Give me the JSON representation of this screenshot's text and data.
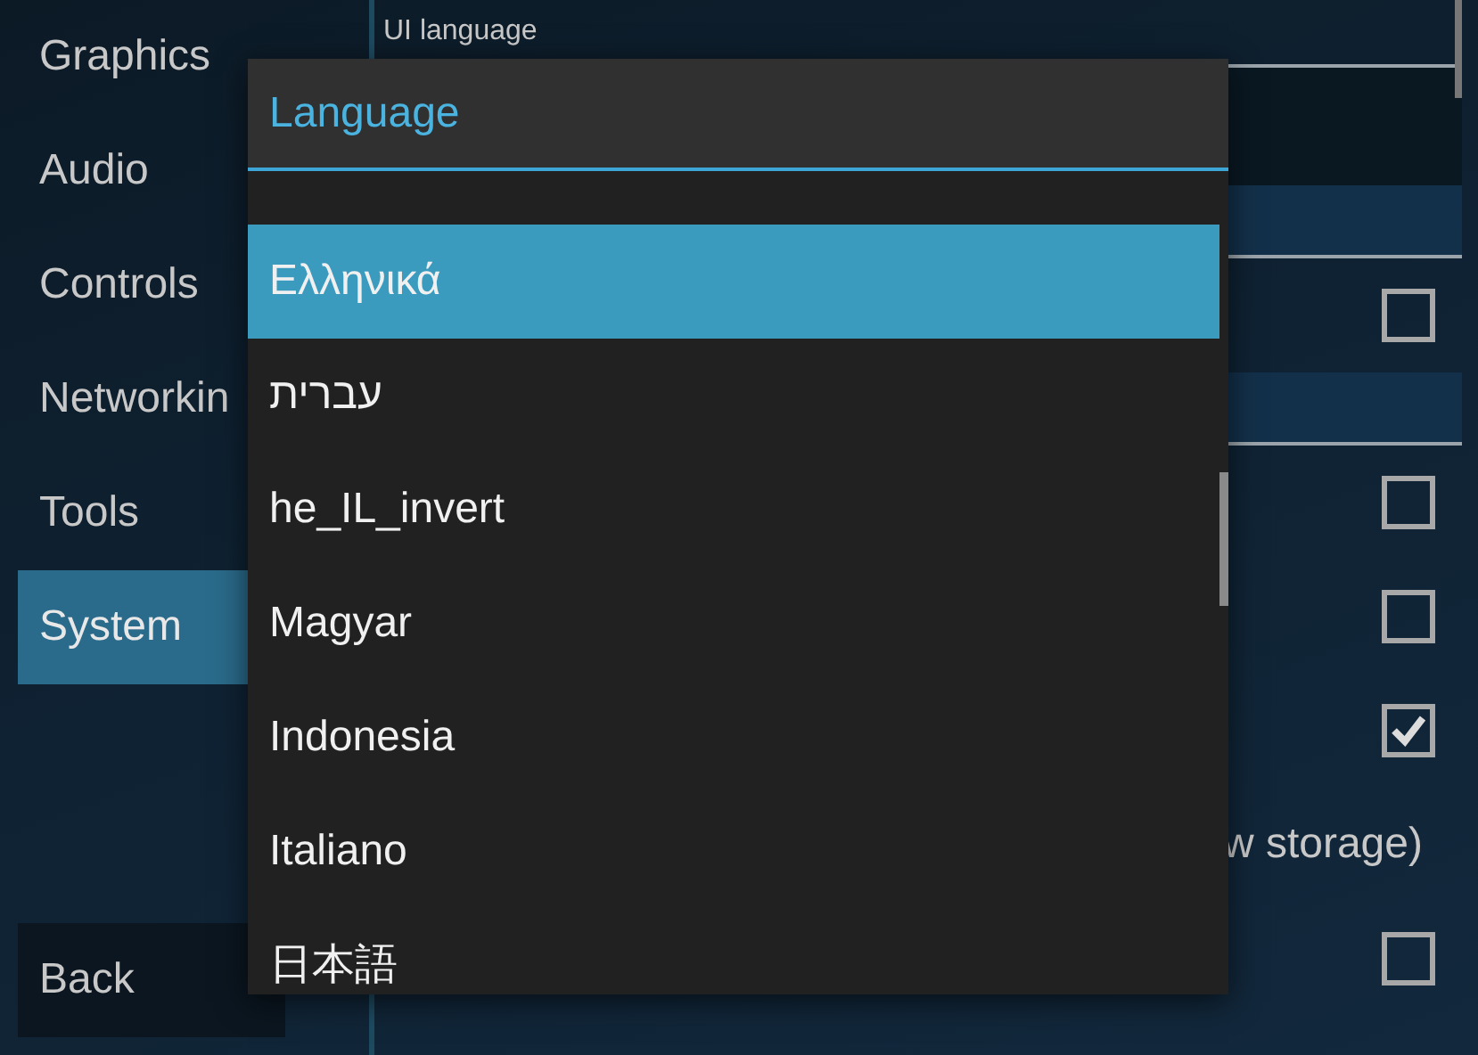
{
  "sidebar": {
    "items": [
      {
        "label": "Graphics",
        "selected": false
      },
      {
        "label": "Audio",
        "selected": false
      },
      {
        "label": "Controls",
        "selected": false
      },
      {
        "label": "Networkin",
        "selected": false
      },
      {
        "label": "Tools",
        "selected": false
      },
      {
        "label": "System",
        "selected": true
      }
    ],
    "back_button": "Back"
  },
  "settings": {
    "rows": [
      {
        "kind": "header",
        "label": "UI language"
      },
      {
        "kind": "blank"
      },
      {
        "kind": "band"
      },
      {
        "kind": "checkbox",
        "checked": false
      },
      {
        "kind": "band"
      },
      {
        "kind": "checkbox",
        "checked": false
      },
      {
        "kind": "checkbox",
        "checked": false
      },
      {
        "kind": "checkbox",
        "checked": true
      },
      {
        "kind": "text",
        "label": "w storage)"
      },
      {
        "kind": "checkbox",
        "checked": false
      }
    ]
  },
  "popup": {
    "title": "Language",
    "items": [
      {
        "label": "Ελληνικά",
        "selected": true
      },
      {
        "label": "עברית",
        "selected": false
      },
      {
        "label": "he_IL_invert",
        "selected": false
      },
      {
        "label": "Magyar",
        "selected": false
      },
      {
        "label": "Indonesia",
        "selected": false
      },
      {
        "label": "Italiano",
        "selected": false
      },
      {
        "label": "日本語",
        "selected": false
      }
    ]
  }
}
